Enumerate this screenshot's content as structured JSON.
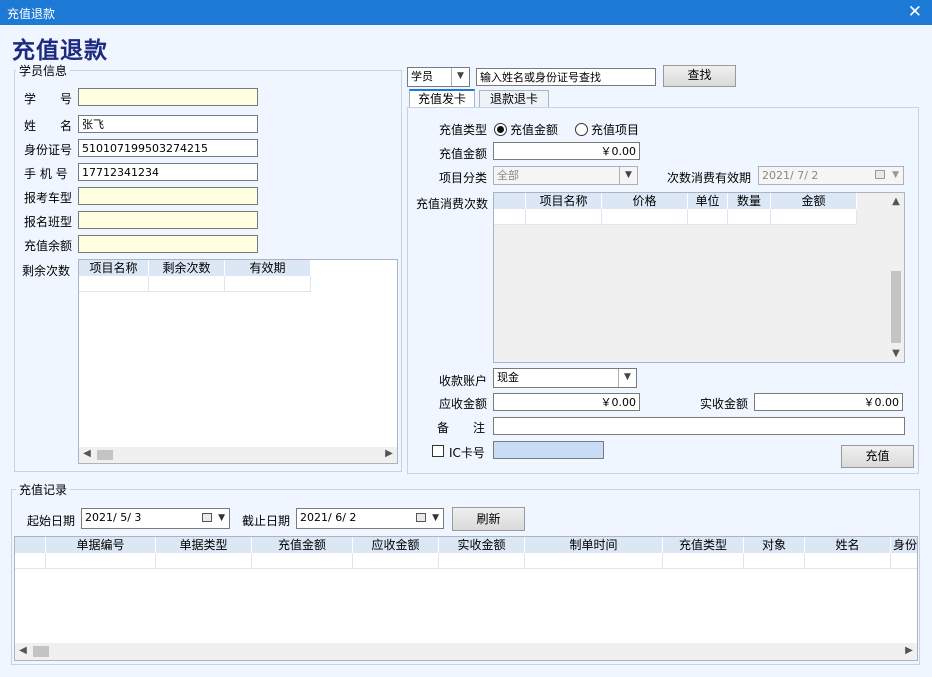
{
  "window": {
    "title": "充值退款",
    "heading": "充值退款",
    "close_glyph": "✕"
  },
  "student": {
    "group_label": "学员信息",
    "fields": {
      "id_label": "学　　号",
      "id_value": "",
      "name_label": "姓　　名",
      "name_value": "张飞",
      "idcard_label": "身份证号",
      "idcard_value": "510107199503274215",
      "phone_label": "手 机 号",
      "phone_value": "17712341234",
      "exam_car_label": "报考车型",
      "exam_car_value": "",
      "class_label": "报名班型",
      "class_value": "",
      "balance_label": "充值余额",
      "balance_value": ""
    },
    "remaining_label": "剩余次数",
    "remaining_columns": [
      "项目名称",
      "剩余次数",
      "有效期"
    ]
  },
  "search": {
    "type_value": "学员",
    "input_value": "输入姓名或身份证号查找",
    "button_label": "查找"
  },
  "tabs": [
    {
      "label": "充值发卡",
      "active": true
    },
    {
      "label": "退款退卡",
      "active": false
    }
  ],
  "recharge": {
    "type_label": "充值类型",
    "option_amount": "充值金额",
    "option_item": "充值项目",
    "selected": "充值金额",
    "amount_label": "充值金额",
    "amount_value": "￥0.00",
    "category_label": "项目分类",
    "category_value": "全部",
    "validity_label": "次数消费有效期",
    "validity_value": "2021/ 7/ 2",
    "count_label": "充值消费次数",
    "count_columns": [
      "项目名称",
      "价格",
      "单位",
      "数量",
      "金额"
    ],
    "account_label": "收款账户",
    "account_value": "现金",
    "receivable_label": "应收金额",
    "receivable_value": "￥0.00",
    "received_label": "实收金额",
    "received_value": "￥0.00",
    "remark_label": "备　　注",
    "remark_value": "",
    "ic_label": "IC卡号",
    "ic_value": "",
    "submit_label": "充值"
  },
  "records": {
    "group_label": "充值记录",
    "start_label": "起始日期",
    "start_value": "2021/ 5/ 3",
    "end_label": "截止日期",
    "end_value": "2021/ 6/ 2",
    "refresh_label": "刷新",
    "columns": [
      "单据编号",
      "单据类型",
      "充值金额",
      "应收金额",
      "实收金额",
      "制单时间",
      "充值类型",
      "对象",
      "姓名",
      "身份证号"
    ]
  },
  "icons": {
    "calendar": "calendar-icon",
    "dropdown": "chevron-down-icon",
    "scroll_left": "◀",
    "scroll_right": "▶"
  }
}
